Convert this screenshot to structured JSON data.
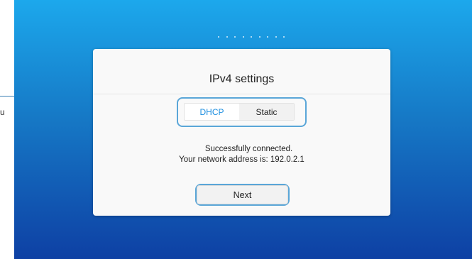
{
  "annotation": {
    "letter": "u"
  },
  "setup": {
    "step_dots": 9
  },
  "card": {
    "title": "IPv4 settings",
    "tabs": [
      {
        "label": "DHCP",
        "selected": true
      },
      {
        "label": "Static",
        "selected": false
      }
    ],
    "status_line1": "Successfully connected.",
    "status_line2": "Your network address is: 192.0.2.1",
    "next_label": "Next"
  },
  "colors": {
    "background_top": "#1ca8ec",
    "background_bottom": "#0e40a4",
    "accent": "#1e8fe0",
    "highlight": "#5aa6d8"
  }
}
